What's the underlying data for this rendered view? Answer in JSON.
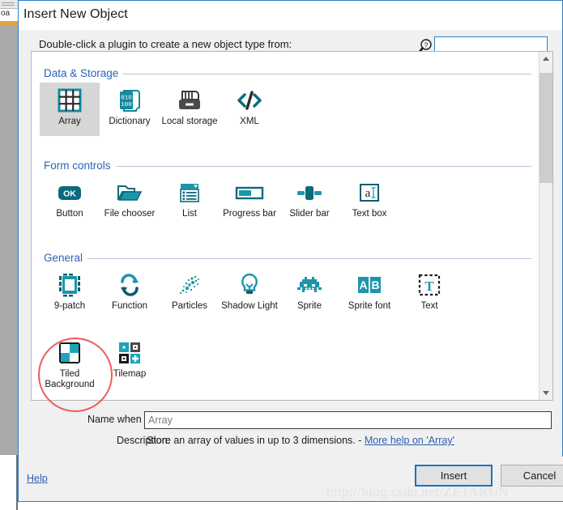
{
  "background_window": {
    "tab_text": "oa"
  },
  "dialog": {
    "title": "Insert New Object",
    "prompt": "Double-click a plugin to create a new object type from:",
    "search": {
      "value": "",
      "placeholder": "",
      "icon": "magnifier-question-icon"
    },
    "groups": [
      {
        "title": "Data & Storage",
        "items": [
          {
            "label": "Array",
            "icon": "grid-icon",
            "selected": true
          },
          {
            "label": "Dictionary",
            "icon": "binary-book-icon",
            "selected": false
          },
          {
            "label": "Local storage",
            "icon": "hard-drive-icon",
            "selected": false
          },
          {
            "label": "XML",
            "icon": "code-brackets-icon",
            "selected": false
          }
        ]
      },
      {
        "title": "Form controls",
        "items": [
          {
            "label": "Button",
            "icon": "ok-button-icon",
            "selected": false
          },
          {
            "label": "File chooser",
            "icon": "open-folder-icon",
            "selected": false
          },
          {
            "label": "List",
            "icon": "list-dropdown-icon",
            "selected": false
          },
          {
            "label": "Progress bar",
            "icon": "progress-bar-icon",
            "selected": false
          },
          {
            "label": "Slider bar",
            "icon": "slider-bar-icon",
            "selected": false
          },
          {
            "label": "Text box",
            "icon": "text-box-icon",
            "selected": false
          }
        ]
      },
      {
        "title": "General",
        "items": [
          {
            "label": "9-patch",
            "icon": "nine-patch-icon",
            "selected": false
          },
          {
            "label": "Function",
            "icon": "arrows-loop-icon",
            "selected": false
          },
          {
            "label": "Particles",
            "icon": "particles-icon",
            "selected": false
          },
          {
            "label": "Shadow Light",
            "icon": "lightbulb-icon",
            "selected": false
          },
          {
            "label": "Sprite",
            "icon": "space-invader-icon",
            "selected": false
          },
          {
            "label": "Sprite font",
            "icon": "ab-letters-icon",
            "selected": false
          },
          {
            "label": "Text",
            "icon": "dashed-t-icon",
            "selected": false
          }
        ]
      },
      {
        "title": "",
        "items": [
          {
            "label": "Tiled Background",
            "icon": "checker-tiles-icon",
            "selected": false,
            "annotated": true
          },
          {
            "label": "Tilemap",
            "icon": "tilemap-icon",
            "selected": false
          }
        ]
      }
    ],
    "scrollbar": {
      "up_arrow": "chevron-up-icon",
      "down_arrow": "chevron-down-icon"
    },
    "name_field": {
      "label": "Name when inserted:",
      "value": "Array",
      "placeholder": "Array"
    },
    "description": {
      "label": "Description:",
      "text": "Store an array of values in up to 3 dimensions. - ",
      "link": "More help on 'Array'"
    },
    "footer": {
      "help": "Help",
      "insert": "Insert",
      "cancel": "Cancel"
    }
  },
  "watermark": "http://blog.csdn.net/ZETARUN",
  "colors": {
    "accent_teal": "#128a9c",
    "link_blue": "#2a5db0",
    "group_title_blue": "#2b63b3",
    "dialog_border": "#2a7fc9",
    "annotation_red": "#ef5a5a",
    "selection_gray": "#d6d6d6"
  }
}
